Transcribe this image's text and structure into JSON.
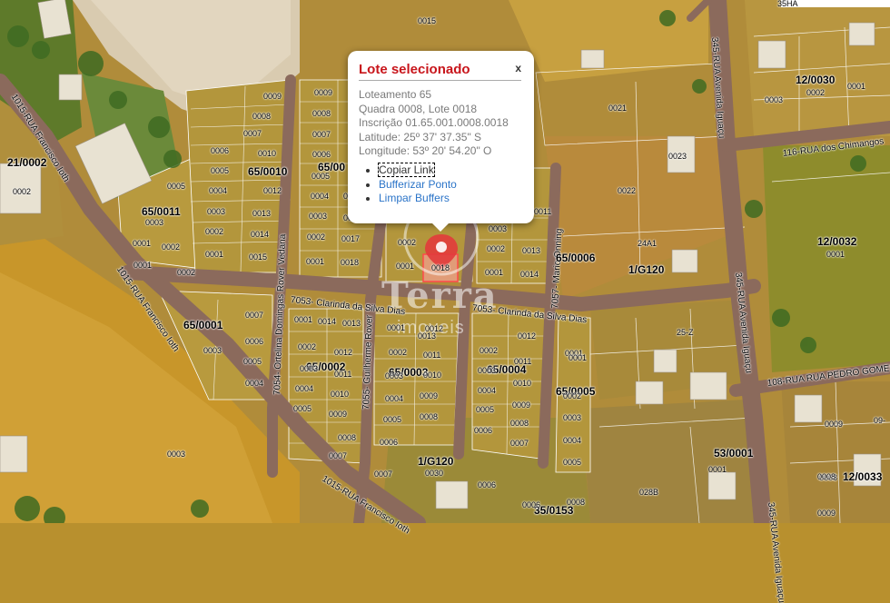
{
  "popup": {
    "title": "Lote selecionado",
    "close": "x",
    "lines": [
      "Loteamento 65",
      "Quadra 0008, Lote 0018",
      "Inscrição 01.65.001.0008.0018",
      "Latitude: 25º 37' 37.35\" S",
      "Longitude: 53º 20' 54.20\" O"
    ],
    "links": [
      "Copiar Link",
      "Bufferizar Ponto",
      "Limpar Buffers"
    ]
  },
  "watermark": {
    "brand": "Terra",
    "sub": "imoveis"
  },
  "streets": [
    "1015-RUA Francisco Ioth",
    "1015-RUA Francisco Ioth",
    "1015-RUA Francisco Ioth",
    "7053- Clarinda da Silva Dias",
    "7053- Clarinda da Silva Dias",
    "7054- Ortelina Domingas Rover Vedana",
    "7055- Guilherme Rover",
    "7057- Mario Onning",
    "345-RUA Avenida Iguaçu",
    "345-RUA Avenida Iguaçu",
    "345-RUA Avenida Iguaçu",
    "116-RUA dos Chimangos",
    "108-RUA RUA PEDRO GOMES DE"
  ],
  "blocks": [
    "21/0002",
    "65/0011",
    "65/0010",
    "65/00",
    "65/0006",
    "65/0001",
    "65/0002",
    "65/0003",
    "65/0004",
    "65/0005",
    "1/G120",
    "1/G120",
    "12/0030",
    "12/0032",
    "53/0001",
    "12/0033",
    "35/0153",
    "35HA"
  ],
  "lots": [
    "0015",
    "0009",
    "0008",
    "0007",
    "0006",
    "0005",
    "0004",
    "0003",
    "0002",
    "0001",
    "0010",
    "0012",
    "0013",
    "0014",
    "0015",
    "0009",
    "0008",
    "0007",
    "0006",
    "0005",
    "0004",
    "0003",
    "0002",
    "0001",
    "0017",
    "0018",
    "0016",
    "0015",
    "0002",
    "0001",
    "0003",
    "0002",
    "0001",
    "0013",
    "0014",
    "0011",
    "0018",
    "0005",
    "0003",
    "0001",
    "0002",
    "0007",
    "0006",
    "0005",
    "0004",
    "0003",
    "0001",
    "0014",
    "0013",
    "0002",
    "0012",
    "0003",
    "0011",
    "0004",
    "0010",
    "0005",
    "0009",
    "0008",
    "0007",
    "0001",
    "0012",
    "0013",
    "0002",
    "0011",
    "0003",
    "0010",
    "0004",
    "0009",
    "0005",
    "0008",
    "0006",
    "0007",
    "0002",
    "0012",
    "0003",
    "0011",
    "0004",
    "0010",
    "0005",
    "0009",
    "0006",
    "0008",
    "0007",
    "0001",
    "0002",
    "0003",
    "0004",
    "0005",
    "0021",
    "0022",
    "0023",
    "24A1",
    "0001",
    "0002",
    "0003",
    "0001",
    "0002",
    "0003",
    "0001",
    "25-Z",
    "0008",
    "0009",
    "0008",
    "0006",
    "028B",
    "0030",
    "0001",
    "09-",
    "0008",
    "0002",
    "0001",
    "0006",
    "0009"
  ],
  "lot_highlight": "0018"
}
